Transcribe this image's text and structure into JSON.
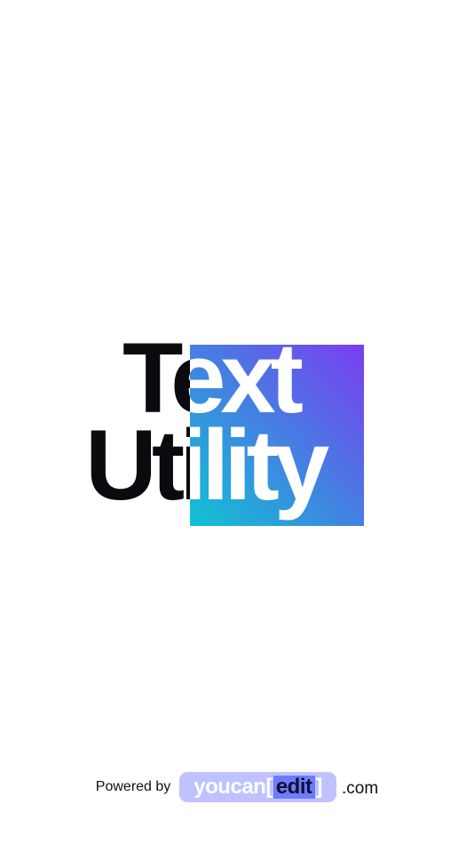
{
  "logo": {
    "word_top": "Text",
    "word_bottom": "Utility",
    "gradient_start": "#0fc3d4",
    "gradient_end": "#7a3df0",
    "text_dark": "#0a0a0f",
    "text_light": "#ffffff"
  },
  "footer": {
    "powered_by": "Powered by",
    "brand_part1": "youcan",
    "brand_bracket_open": "[",
    "brand_part2": "edit",
    "brand_bracket_close": "]",
    "domain_suffix": ".com",
    "badge_color": "#bfc2ff",
    "highlight_color": "#6b7cff"
  }
}
